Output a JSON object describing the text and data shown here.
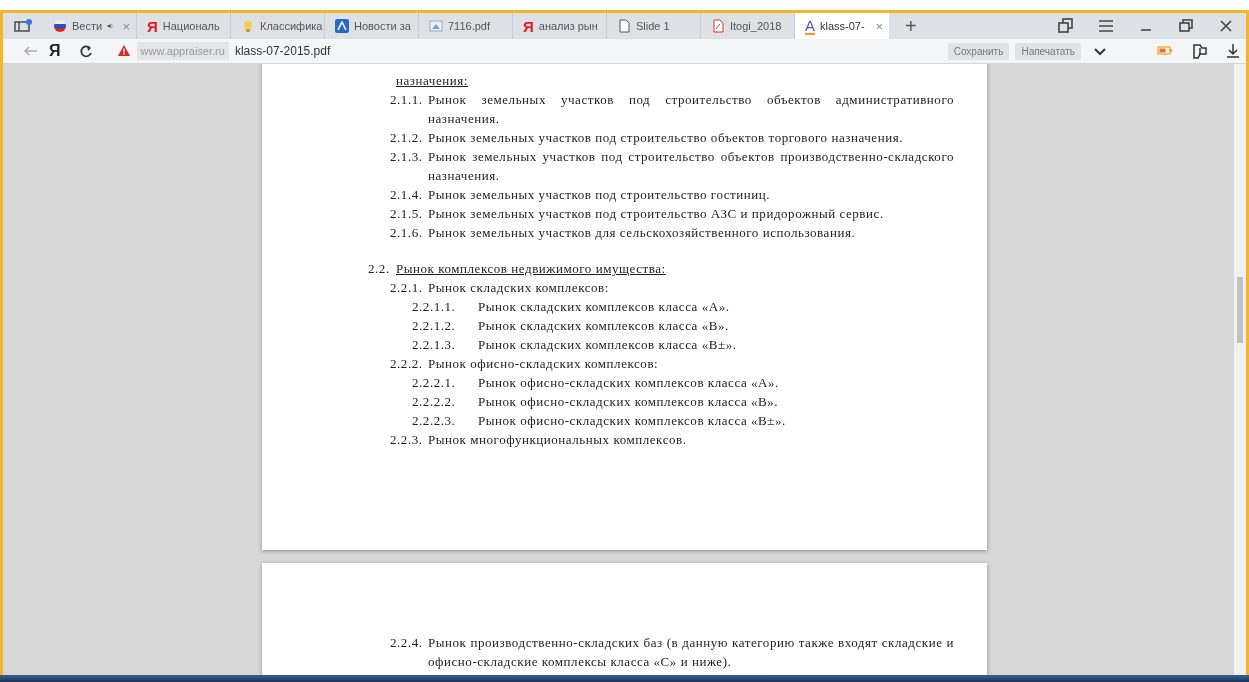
{
  "tabs": [
    {
      "kind": "flag",
      "title": "Вести",
      "audio": true,
      "close": "×",
      "selected": false
    },
    {
      "kind": "glyph",
      "glyph": "Я",
      "title": "Националь",
      "audio": false,
      "selected": false
    },
    {
      "kind": "lamp",
      "title": "Классифика",
      "audio": false,
      "selected": false
    },
    {
      "kind": "news",
      "title": "Новости за",
      "audio": false,
      "selected": false
    },
    {
      "kind": "image",
      "title": "7116.pdf",
      "audio": false,
      "selected": false
    },
    {
      "kind": "glyph",
      "glyph": "Я",
      "title": "анализ рын",
      "audio": false,
      "selected": false
    },
    {
      "kind": "page",
      "title": "Slide 1",
      "audio": false,
      "selected": false
    },
    {
      "kind": "pdf",
      "title": "Itogi_2018",
      "audio": false,
      "selected": false
    },
    {
      "kind": "glyph",
      "glyph": "A",
      "title": "klass-07-",
      "audio": false,
      "close": "×",
      "selected": true
    }
  ],
  "new_tab": "+",
  "address_bar": {
    "home_glyph": "Я",
    "domain": "www.appraiser.ru",
    "path": "klass-07-2015.pdf",
    "buttons": [
      "Сохранить",
      "Напечатать"
    ]
  },
  "pages": [
    {
      "items": [
        {
          "kind": "heading",
          "text": "назначения:",
          "children": [
            {
              "kind": "item",
              "number": "2.1.1.",
              "text": "Рынок земельных участков под строительство объектов административного назначения."
            },
            {
              "kind": "item",
              "number": "2.1.2.",
              "text": "Рынок земельных участков под строительство объектов торгового назначения."
            },
            {
              "kind": "item",
              "number": "2.1.3.",
              "text": "Рынок земельных участков под строительство объектов производственно-складского назначения."
            },
            {
              "kind": "item",
              "number": "2.1.4.",
              "text": "Рынок земельных участков под строительство гостиниц."
            },
            {
              "kind": "item",
              "number": "2.1.5.",
              "text": "Рынок земельных участков под строительство АЗС и придорожный сервис."
            },
            {
              "kind": "item",
              "number": "2.1.6.",
              "text": "Рынок земельных участков для сельскохозяйственного использования."
            }
          ]
        },
        {
          "kind": "heading",
          "number": "2.2.",
          "text": "Рынок комплексов недвижимого имущества:",
          "children": [
            {
              "kind": "item",
              "number": "2.2.1.",
              "text": "Рынок складских комплексов:",
              "children": [
                {
                  "kind": "item",
                  "number": "2.2.1.1.",
                  "text": "Рынок складских комплексов класса «А»."
                },
                {
                  "kind": "item",
                  "number": "2.2.1.2.",
                  "text": "Рынок складских комплексов класса «В»."
                },
                {
                  "kind": "item",
                  "number": "2.2.1.3.",
                  "text": "Рынок складских комплексов класса «В±»."
                }
              ]
            },
            {
              "kind": "item",
              "number": "2.2.2.",
              "text": "Рынок офисно-складских комплексов:",
              "children": [
                {
                  "kind": "item",
                  "number": "2.2.2.1.",
                  "text": "Рынок офисно-складских комплексов класса «А»."
                },
                {
                  "kind": "item",
                  "number": "2.2.2.2.",
                  "text": "Рынок офисно-складских комплексов класса «В»."
                },
                {
                  "kind": "item",
                  "number": "2.2.2.3.",
                  "text": "Рынок офисно-складских комплексов класса «В±»."
                }
              ]
            },
            {
              "kind": "item",
              "number": "2.2.3.",
              "text": "Рынок многофункциональных комплексов."
            }
          ]
        }
      ]
    },
    {
      "items": [
        {
          "kind": "item",
          "number": "2.2.4.",
          "text": "Рынок производственно-складских баз (в данную категорию также входят складские и офисно-складские комплексы класса «С» и ниже)."
        }
      ]
    }
  ]
}
